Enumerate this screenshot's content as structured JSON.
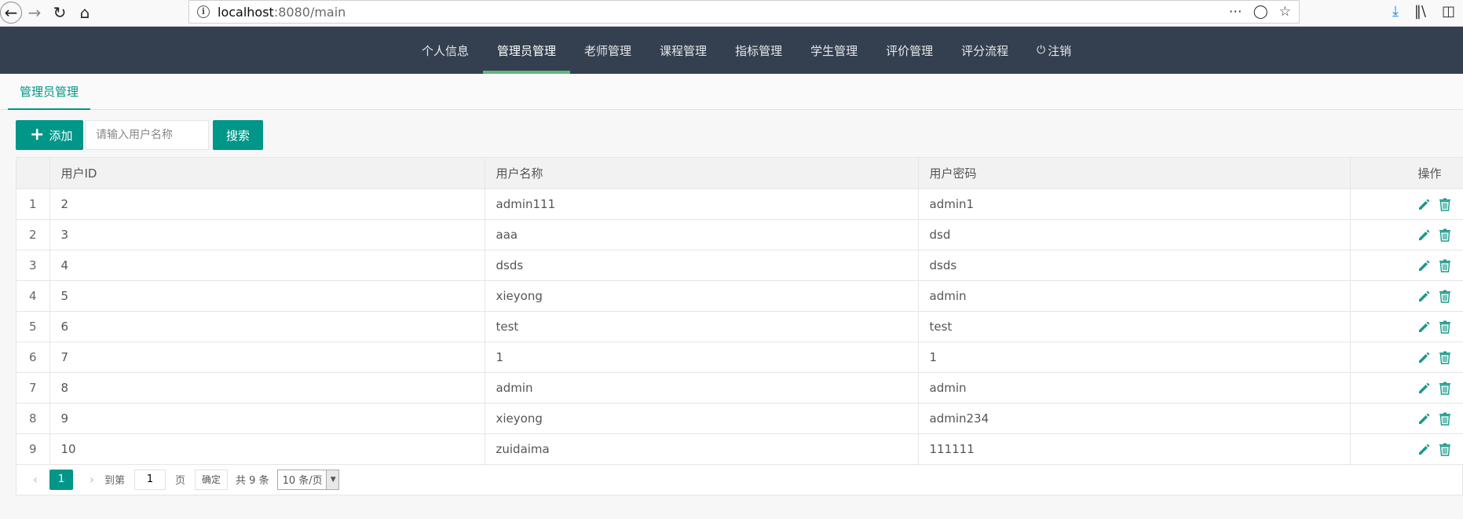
{
  "browser": {
    "url_host": "localhost",
    "url_rest": ":8080/main"
  },
  "nav": {
    "items": [
      {
        "label": "个人信息"
      },
      {
        "label": "管理员管理"
      },
      {
        "label": "老师管理"
      },
      {
        "label": "课程管理"
      },
      {
        "label": "指标管理"
      },
      {
        "label": "学生管理"
      },
      {
        "label": "评价管理"
      },
      {
        "label": "评分流程"
      },
      {
        "label": "注销"
      }
    ],
    "active_index": 1
  },
  "tab": {
    "label": "管理员管理"
  },
  "toolbar": {
    "add_label": "添加",
    "search_placeholder": "请输入用户名称",
    "search_label": "搜索"
  },
  "table": {
    "headers": {
      "id": "用户ID",
      "name": "用户名称",
      "password": "用户密码",
      "ops": "操作"
    },
    "rows": [
      {
        "idx": "1",
        "id": "2",
        "name": "admin111",
        "password": "admin1"
      },
      {
        "idx": "2",
        "id": "3",
        "name": "aaa",
        "password": "dsd"
      },
      {
        "idx": "3",
        "id": "4",
        "name": "dsds",
        "password": "dsds"
      },
      {
        "idx": "4",
        "id": "5",
        "name": "xieyong",
        "password": "admin"
      },
      {
        "idx": "5",
        "id": "6",
        "name": "test",
        "password": "test"
      },
      {
        "idx": "6",
        "id": "7",
        "name": "1",
        "password": "1"
      },
      {
        "idx": "7",
        "id": "8",
        "name": "admin",
        "password": "admin"
      },
      {
        "idx": "8",
        "id": "9",
        "name": "xieyong",
        "password": "admin234"
      },
      {
        "idx": "9",
        "id": "10",
        "name": "zuidaima",
        "password": "111111"
      }
    ]
  },
  "pager": {
    "current": "1",
    "goto_label": "到第",
    "page_input": "1",
    "page_unit": "页",
    "confirm_label": "确定",
    "total_label": "共 9 条",
    "page_size": "10 条/页"
  },
  "colors": {
    "header_bg": "#343f4f",
    "accent": "#009688",
    "active_nav_underline": "#5fb878"
  },
  "icons": {
    "row_actions": [
      "edit-pencil-icon",
      "delete-trash-icon"
    ]
  }
}
